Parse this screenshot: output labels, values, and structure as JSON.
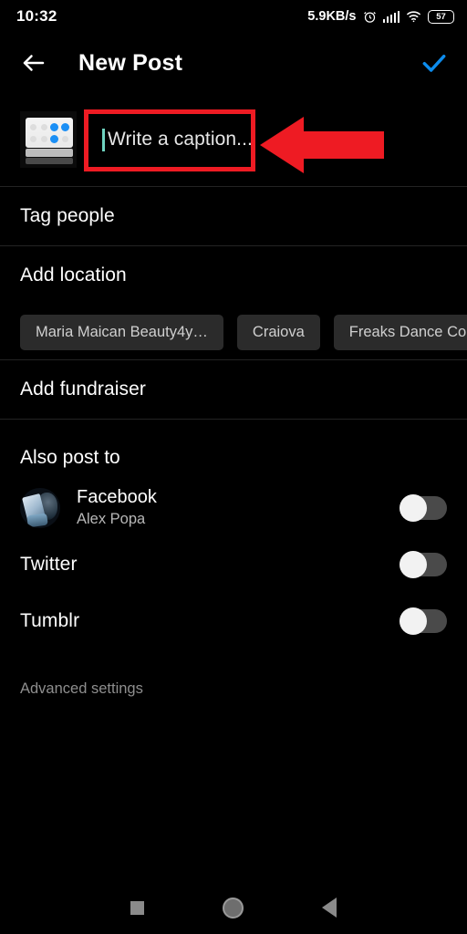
{
  "statusbar": {
    "time": "10:32",
    "network_speed": "5.9KB/s",
    "alarm_icon": "alarm-clock-icon",
    "signal_icon": "cellular-signal-icon",
    "wifi_icon": "wifi-icon",
    "battery_level": "57"
  },
  "appbar": {
    "back_icon": "back-arrow-icon",
    "title": "New Post",
    "confirm_icon": "checkmark-icon",
    "accent_color": "#0d8ced"
  },
  "caption": {
    "thumbnail_alt": "post-image-thumbnail",
    "placeholder": "Write a caption..."
  },
  "annotation": {
    "box_color": "#ee1b23",
    "arrow_color": "#ee1b23",
    "arrow_direction": "left"
  },
  "rows": {
    "tag_people": "Tag people",
    "add_location": "Add location",
    "add_fundraiser": "Add fundraiser"
  },
  "location_chips": [
    {
      "label": "Maria Maican Beauty4y…"
    },
    {
      "label": "Craiova"
    },
    {
      "label": "Freaks Dance Co"
    }
  ],
  "also_post_to": {
    "heading": "Also post to",
    "accounts": [
      {
        "name": "Facebook",
        "subtitle": "Alex Popa",
        "enabled": false,
        "avatar": "joker-avatar"
      },
      {
        "name": "Twitter",
        "subtitle": "",
        "enabled": false
      },
      {
        "name": "Tumblr",
        "subtitle": "",
        "enabled": false
      }
    ]
  },
  "advanced_settings": "Advanced settings",
  "navbar": {
    "recents_icon": "square-recents-icon",
    "home_icon": "circle-home-icon",
    "back_icon": "triangle-back-icon"
  }
}
